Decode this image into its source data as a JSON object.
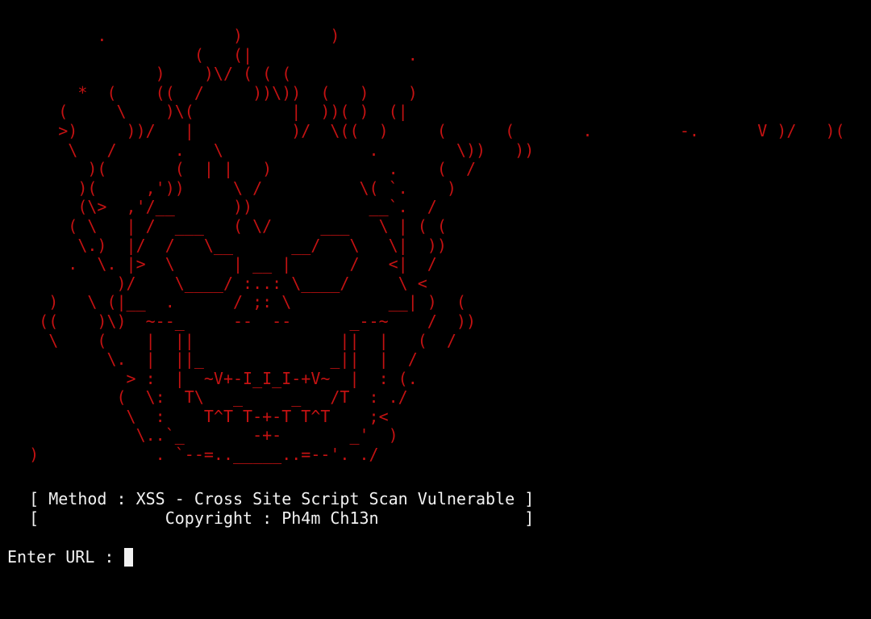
{
  "terminal": {
    "art_color": "#c41212",
    "text_color": "#f2f2f2",
    "background": "#000000",
    "art_lines": [
      "          .             )         )",
      "                    (   (|                .",
      "                )    )\\/ ( ( (",
      "        *  (    ((  /     ))\\))  (   )    )",
      "      (     \\    )\\(          |  ))( )  (|",
      "      >)     ))/   |          )/  \\((  )     (      (       .         -.      V )/   )(    (",
      "       \\   /      .   \\               .        \\))   ))",
      "         )(       (  | |   )            .    (  /",
      "        )(     ,'))     \\ /          \\( `.    )",
      "        (\\>  ,'/__      ))            __`.  /",
      "       ( \\   | /  ___   ( \\/     ___   \\ | ( (",
      "        \\.)  |/  /   \\__      __/   \\   \\|  ))",
      "       .  \\. |>  \\      | __ |      /   <|  /",
      "            )/    \\____/ :..: \\____/     \\ <",
      "     )   \\ (|__  .      / ;: \\          __| )  (",
      "    ((    )\\)  ~--_     --  --      _--~    /  ))",
      "     \\    (    |  ||               ||  |   (  /",
      "           \\.  |  ||_             _||  |  /",
      "             > :  |  ~V+-I_I_I-+V~  |  : (.",
      "            (  \\:  T\\   _     _   /T  : ./",
      "             \\  :    T^T T-+-T T^T    ;<",
      "              \\..`_       -+-       _'  )",
      "   )            . `--=.._____..=--'. ./"
    ],
    "banner_lines": [
      "   [ Method : XSS - Cross Site Script Scan Vulnerable ]",
      "   [             Copyright : Ph4m Ch13n               ]"
    ],
    "prompt_label": "Enter URL : ",
    "url_value": ""
  }
}
